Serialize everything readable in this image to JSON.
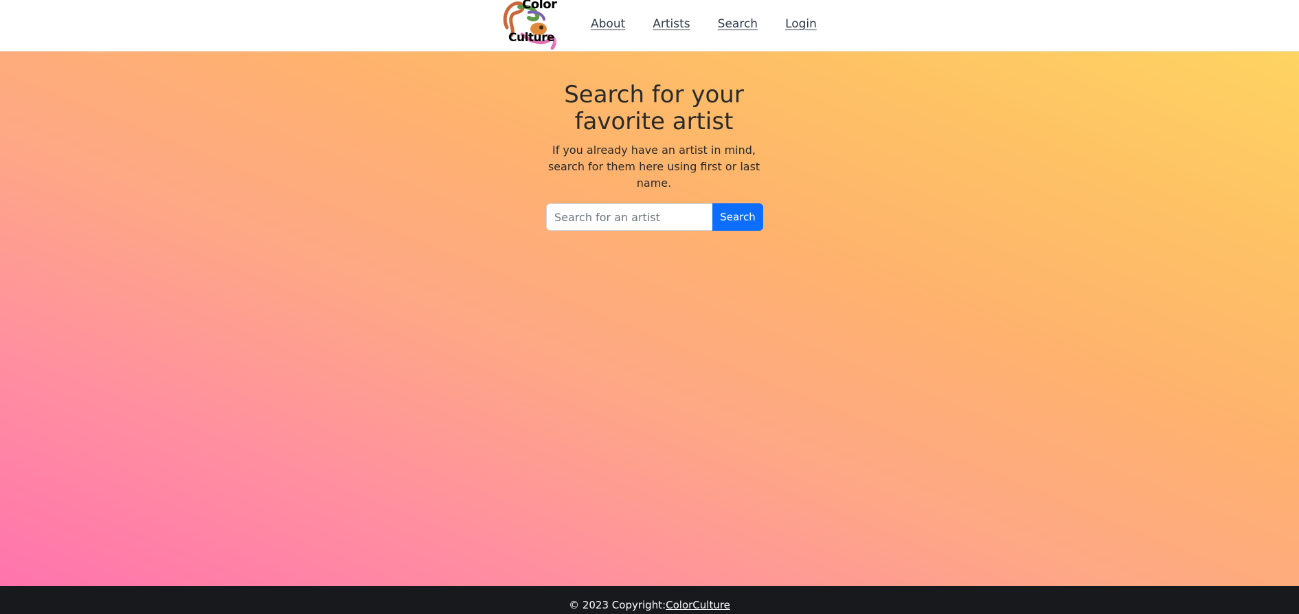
{
  "header": {
    "logo": {
      "line1": "Color",
      "line2": "Culture"
    },
    "nav": [
      {
        "label": "About"
      },
      {
        "label": "Artists"
      },
      {
        "label": "Search"
      },
      {
        "label": "Login"
      }
    ]
  },
  "hero": {
    "title": "Search for your favorite artist",
    "subtitle": "If you already have an artist in mind, search for them here using first or last name."
  },
  "search": {
    "placeholder": "Search for an artist",
    "value": "",
    "button_label": "Search",
    "button_color": "#0d6efd"
  },
  "footer": {
    "copyright": "© 2023 Copyright:",
    "link_label": "ColorCulture"
  },
  "colors": {
    "gradient_start": "#ff74ad",
    "gradient_end": "#fed462",
    "footer_bg": "#17191c"
  }
}
